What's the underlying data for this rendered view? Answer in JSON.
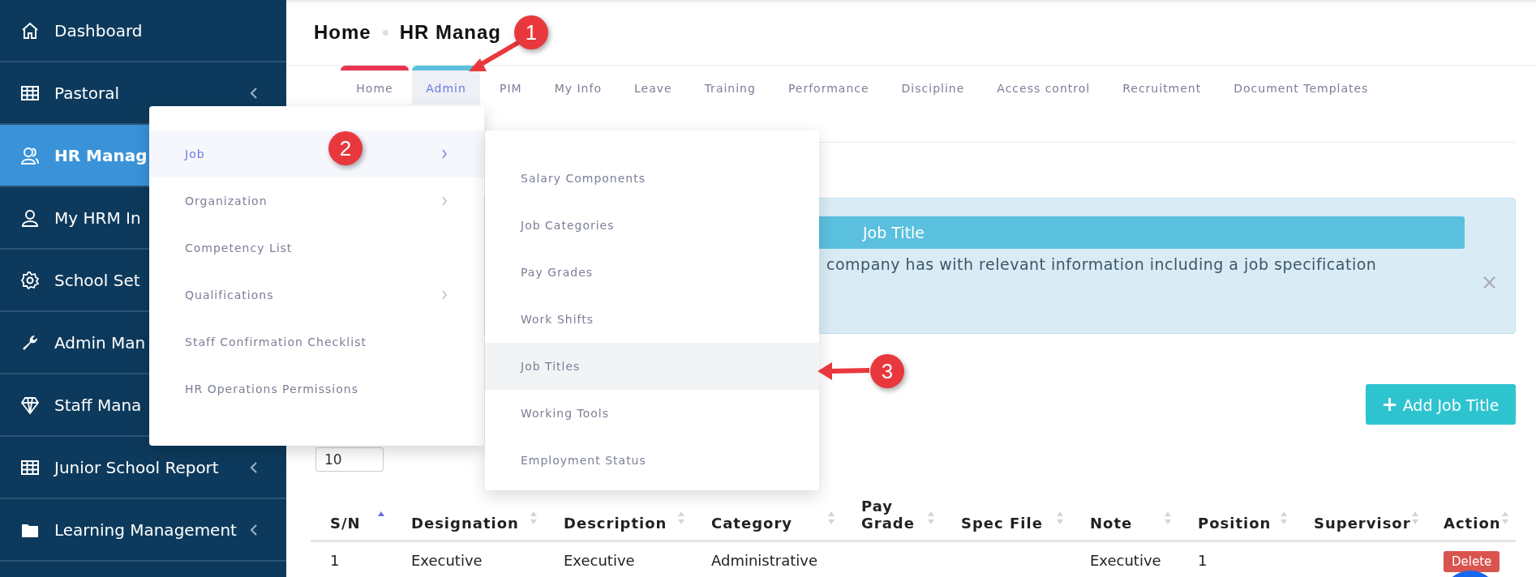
{
  "sidebar": {
    "items": [
      {
        "label": "Dashboard",
        "kind": "home",
        "selected": false,
        "has_submenu": false
      },
      {
        "label": "Pastoral",
        "kind": "table",
        "selected": false,
        "has_submenu": true
      },
      {
        "label": "HR Manag",
        "kind": "users",
        "selected": true,
        "has_submenu": false
      },
      {
        "label": "My HRM In",
        "kind": "user",
        "selected": false
      },
      {
        "label": "School Set",
        "kind": "gear",
        "selected": false
      },
      {
        "label": "Admin Man",
        "kind": "wrench",
        "selected": false
      },
      {
        "label": "Staff Mana",
        "kind": "diamond",
        "selected": false
      },
      {
        "label": "Junior School Report",
        "kind": "table",
        "selected": false,
        "has_submenu": true
      },
      {
        "label": "Learning Management",
        "kind": "folder",
        "selected": false,
        "has_submenu": true
      }
    ]
  },
  "breadcrumb": [
    "Home",
    "HR Manag"
  ],
  "tabs": [
    {
      "label": "Home",
      "selected": false,
      "color": "#e8344e"
    },
    {
      "label": "Admin",
      "selected": true,
      "color": "#5bc0de"
    },
    {
      "label": "PIM",
      "selected": false
    },
    {
      "label": "My Info",
      "selected": false
    },
    {
      "label": "Leave",
      "selected": false
    },
    {
      "label": "Training",
      "selected": false
    },
    {
      "label": "Performance",
      "selected": false
    },
    {
      "label": "Discipline",
      "selected": false
    },
    {
      "label": "Access control",
      "selected": false
    },
    {
      "label": "Recruitment",
      "selected": false
    },
    {
      "label": "Document Templates",
      "selected": false
    }
  ],
  "admin_menu": {
    "items": [
      {
        "label": "Job",
        "selected": true,
        "has_submenu": true
      },
      {
        "label": "Organization",
        "selected": false,
        "has_submenu": true
      },
      {
        "label": "Competency List",
        "selected": false,
        "has_submenu": false
      },
      {
        "label": "Qualifications",
        "selected": false,
        "has_submenu": true
      },
      {
        "label": "Staff Confirmation Checklist",
        "selected": false,
        "has_submenu": false
      },
      {
        "label": "HR Operations Permissions",
        "selected": false,
        "has_submenu": false
      }
    ]
  },
  "job_submenu": {
    "items": [
      {
        "label": "Salary Components",
        "selected": false
      },
      {
        "label": "Job Categories",
        "selected": false
      },
      {
        "label": "Pay Grades",
        "selected": false
      },
      {
        "label": "Work Shifts",
        "selected": false
      },
      {
        "label": "Job Titles",
        "selected": true
      },
      {
        "label": "Working Tools",
        "selected": false
      },
      {
        "label": "Employment Status",
        "selected": false
      }
    ]
  },
  "info_alert": {
    "title": "Job Title",
    "text": "company has with relevant information including a job specification",
    "close": "×"
  },
  "add_button": {
    "icon": "+",
    "label": "Add Job Title"
  },
  "page_size": {
    "value": "10"
  },
  "table": {
    "columns": [
      {
        "label": "S/N",
        "sorted": true
      },
      {
        "label": "Designation",
        "sorted": false
      },
      {
        "label": "Description",
        "sorted": false
      },
      {
        "label": "Category",
        "sorted": false
      },
      {
        "label": "Pay Grade",
        "sorted": false
      },
      {
        "label": "Spec File",
        "sorted": false
      },
      {
        "label": "Note",
        "sorted": false
      },
      {
        "label": "Position",
        "sorted": false
      },
      {
        "label": "Supervisor",
        "sorted": false
      },
      {
        "label": "Action",
        "sorted": false
      }
    ],
    "rows": [
      {
        "cells": [
          "1",
          "Executive",
          "Executive",
          "Administrative",
          null,
          null,
          "Executive",
          "1",
          null,
          "Delete"
        ]
      }
    ]
  },
  "annotations": [
    {
      "number": "1"
    },
    {
      "number": "2"
    },
    {
      "number": "3"
    }
  ]
}
